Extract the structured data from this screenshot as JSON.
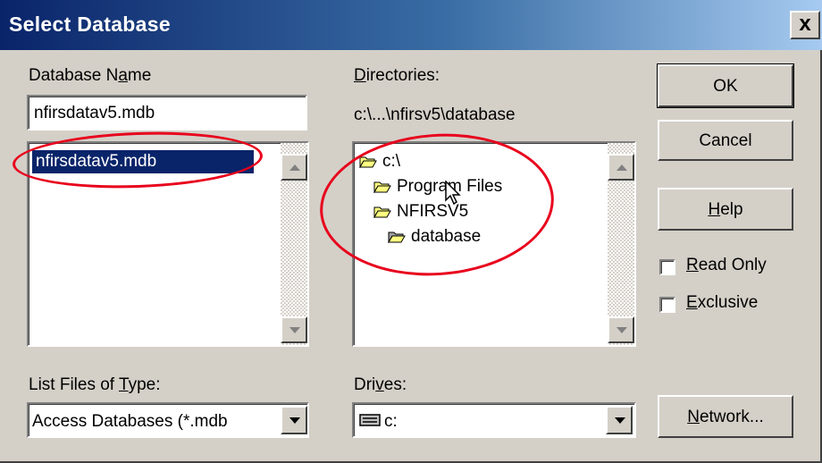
{
  "title": "Select Database",
  "close_label": "x",
  "database_name": {
    "label_prefix": "Database N",
    "label_mnemonic": "a",
    "label_suffix": "me",
    "value": "nfirsdatav5.mdb",
    "files": [
      "nfirsdatav5.mdb"
    ]
  },
  "directories": {
    "label_mnemonic": "D",
    "label_suffix": "irectories:",
    "current_path": "c:\\...\\nfirsv5\\database",
    "tree": [
      "c:\\",
      "Program Files",
      "NFIRSV5",
      "database"
    ]
  },
  "file_type": {
    "label_prefix": "List Files of ",
    "label_mnemonic": "T",
    "label_suffix": "ype:",
    "selected": "Access Databases (*.mdb"
  },
  "drives": {
    "label_prefix": "Dri",
    "label_mnemonic": "v",
    "label_suffix": "es:",
    "selected": "c:"
  },
  "buttons": {
    "ok": "OK",
    "cancel": "Cancel",
    "help_mnemonic": "H",
    "help_suffix": "elp",
    "network_mnemonic": "N",
    "network_suffix": "etwork..."
  },
  "options": {
    "read_only_mnemonic": "R",
    "read_only_suffix": "ead Only",
    "exclusive_mnemonic": "E",
    "exclusive_suffix": "xclusive",
    "read_only_checked": false,
    "exclusive_checked": false
  },
  "colors": {
    "title_gradient_start": "#0a246a",
    "title_gradient_end": "#a6caf0",
    "selection": "#0a246a",
    "annotation_red": "#e8001c",
    "face": "#d4d0c8"
  }
}
